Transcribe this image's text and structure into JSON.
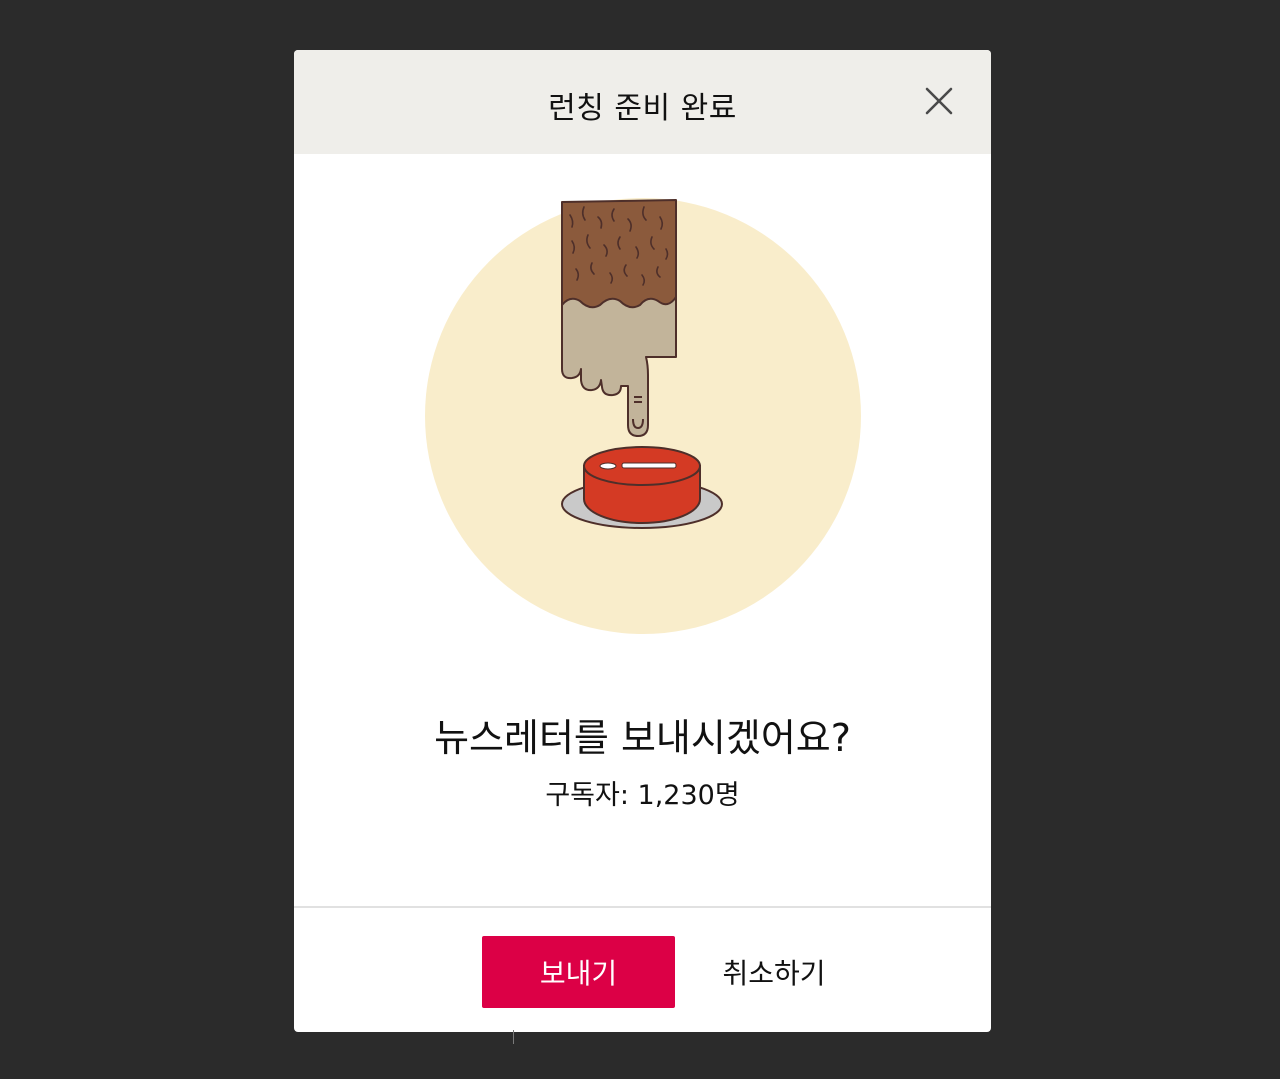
{
  "modal": {
    "title": "런칭 준비 완료",
    "illustration": "finger-pressing-red-button",
    "question": "뉴스레터를 보내시겠어요?",
    "subscribers": "구독자: 1,230명",
    "close_icon": "close-icon"
  },
  "actions": {
    "send_label": "보내기",
    "cancel_label": "취소하기"
  },
  "colors": {
    "backdrop": "#2b2b2b",
    "header_bg": "#efeeea",
    "accent": "#dc0046",
    "circle": "#f9edcb",
    "sleeve": "#8b5a3c",
    "hand": "#c2b49a",
    "button_red": "#d43a24"
  }
}
